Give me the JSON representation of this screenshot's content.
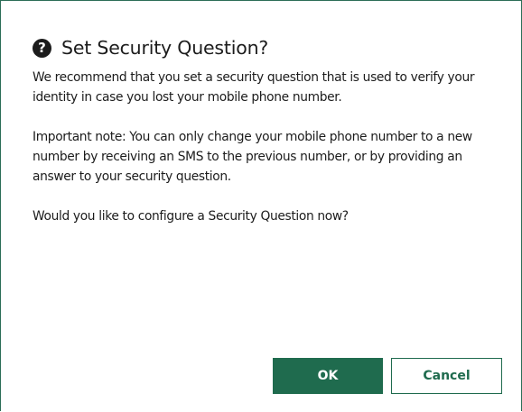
{
  "dialog": {
    "icon": "question-circle-icon",
    "icon_glyph": "?",
    "title": "Set Security Question?",
    "paragraphs": [
      "We recommend that you set a security question that is used to verify your identity in case you lost your mobile phone number.",
      "Important note: You can only change your mobile phone number to a new number by receiving an SMS to the previous number, or by providing an answer to your security question.",
      "Would you like to configure a Security Question now?"
    ],
    "buttons": {
      "ok_label": "OK",
      "cancel_label": "Cancel"
    }
  },
  "colors": {
    "accent": "#1f6b4e",
    "border": "#2c6e57",
    "text": "#1c1c1c",
    "background": "#ffffff"
  }
}
